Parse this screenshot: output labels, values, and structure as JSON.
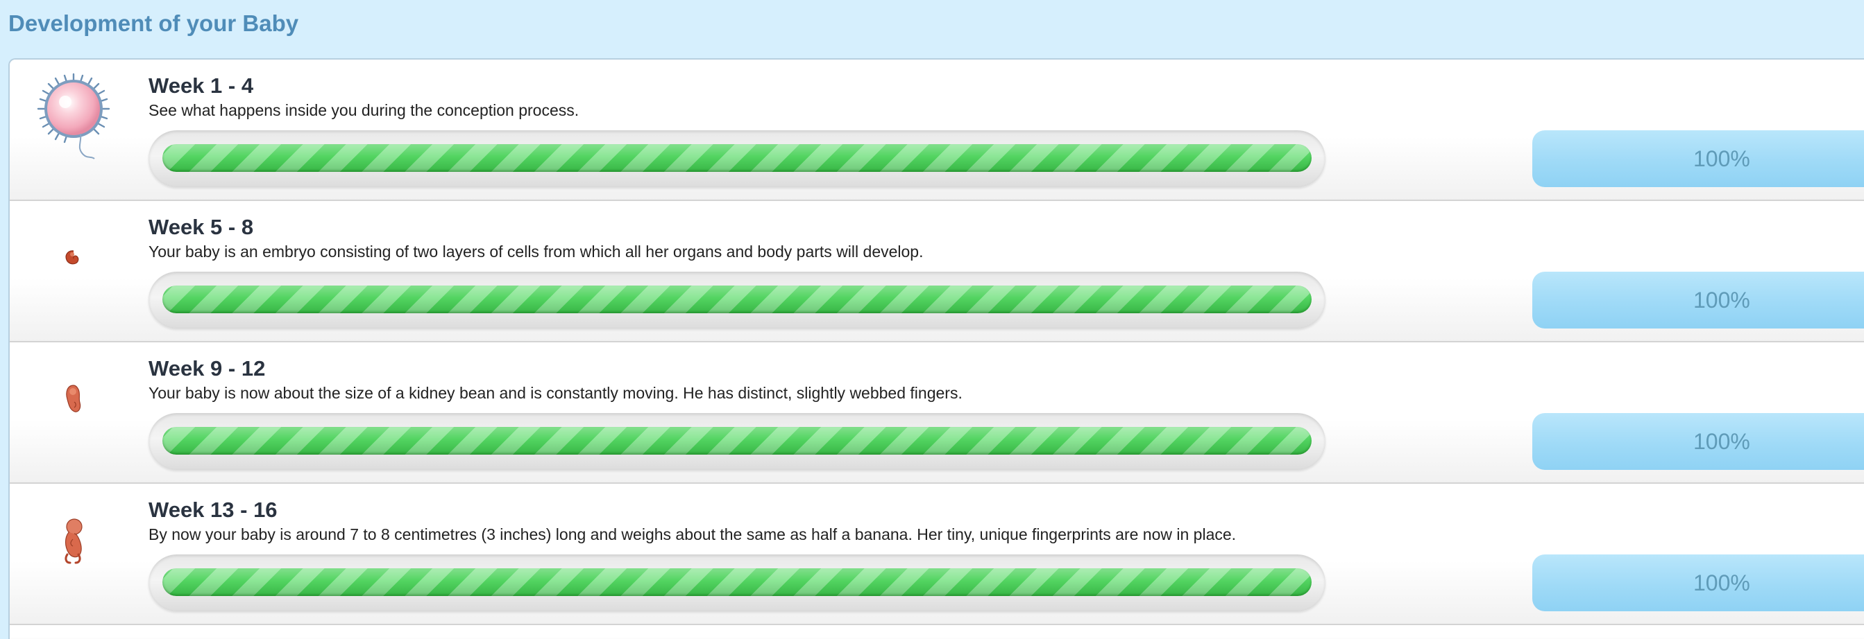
{
  "page": {
    "title": "Development of your Baby"
  },
  "colors": {
    "header_bg": "#d6effd",
    "title_text": "#4f8cb8",
    "progress_green": "#3fcf4f",
    "progress_stripe": "#7fe38a",
    "percent_badge": "#9fdaf7",
    "percent_text": "#5f9bb8"
  },
  "weeks": [
    {
      "title": "Week 1 - 4",
      "description": "See what happens inside you during the conception process.",
      "progress": 1.0,
      "percent_label": "100%",
      "icon": "egg-cell-icon"
    },
    {
      "title": "Week 5 - 8",
      "description": "Your baby is an embryo consisting of two layers of cells from which all her organs and body parts will develop.",
      "progress": 1.0,
      "percent_label": "100%",
      "icon": "embryo-icon"
    },
    {
      "title": "Week 9 - 12",
      "description": "Your baby is now about the size of a kidney bean and is constantly moving. He has distinct, slightly webbed fingers.",
      "progress": 1.0,
      "percent_label": "100%",
      "icon": "embryo-icon"
    },
    {
      "title": "Week 13 - 16",
      "description": "By now your baby is around 7 to 8 centimetres (3 inches) long and weighs about the same as half a banana. Her tiny, unique fingerprints are now in place.",
      "progress": 1.0,
      "percent_label": "100%",
      "icon": "fetus-icon"
    }
  ]
}
